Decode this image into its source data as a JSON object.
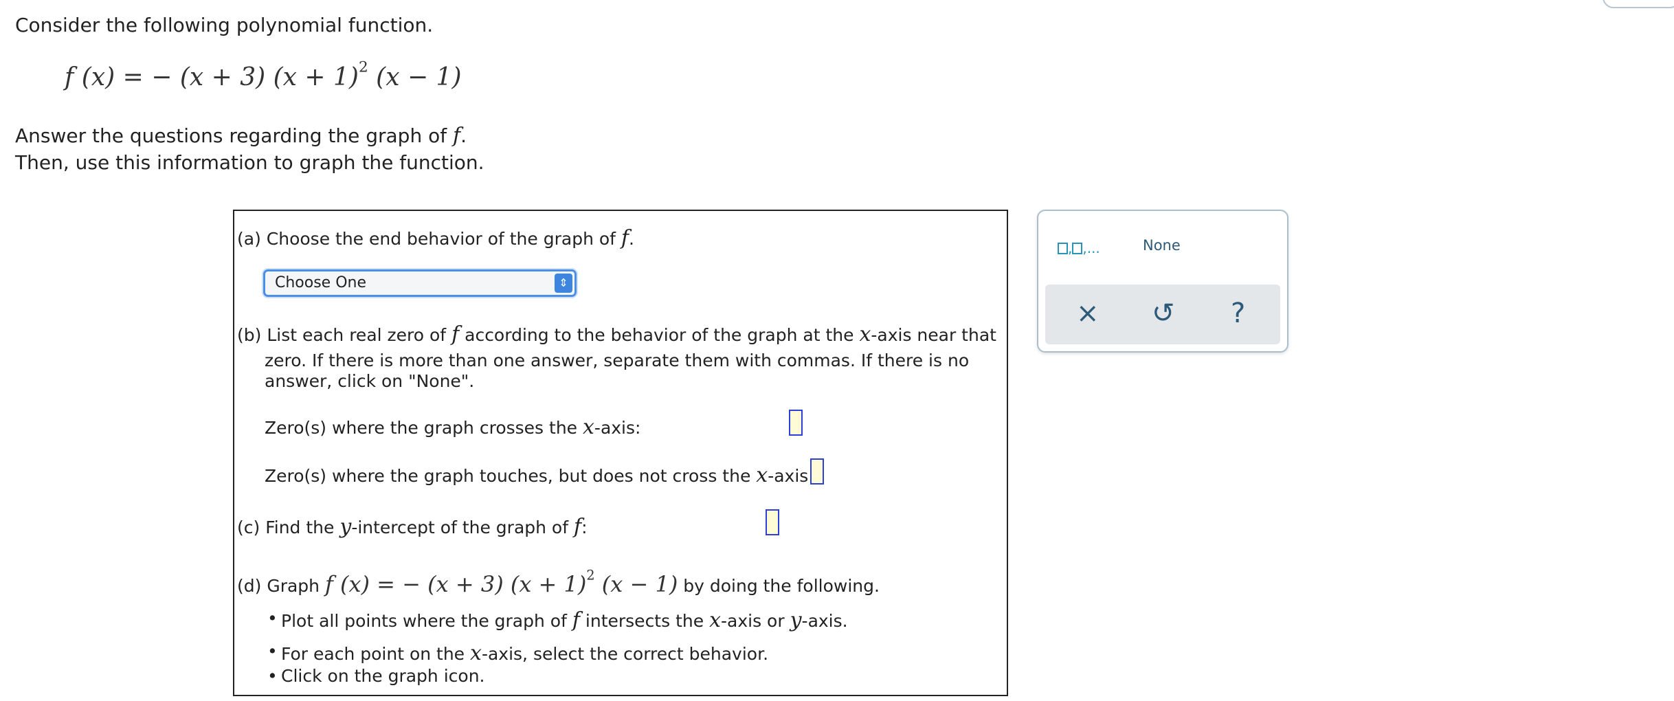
{
  "intro": {
    "line1": "Consider the following polynomial function.",
    "line2": "Answer the questions regarding the graph of",
    "line3": "Then, use this information to graph the function."
  },
  "func": {
    "lhs": "f (x) = − (x + 3) (x + 1)",
    "exp": "2",
    "tail": " (x − 1)"
  },
  "f": "f",
  "x": "x",
  "y": "y",
  "qa": {
    "label": "(a) Choose the end behavior of the graph of",
    "select_value": "Choose One"
  },
  "qb": {
    "line1_pre": "(b) List each real zero of",
    "line1_mid": "according to the behavior of the graph at the",
    "line1_post": "-axis near that",
    "line2": "zero. If there is more than one answer, separate them with commas. If there is no",
    "line3": "answer, click on \"None\".",
    "crosses_pre": "Zero(s) where the graph crosses the",
    "crosses_post": "-axis:",
    "touches_pre": "Zero(s) where the graph touches, but does not cross the",
    "touches_post": "-axis:"
  },
  "qc": {
    "pre": "(c) Find the",
    "mid": "-intercept of the graph of",
    "post": ":"
  },
  "qd": {
    "label": "(d) Graph",
    "suffix": "by doing the following.",
    "b1_pre": "Plot all points where the graph of",
    "b1_mid": "intersects the",
    "b1_mid2": "-axis or",
    "b1_post": "-axis.",
    "b2_pre": "For each point on the",
    "b2_post": "-axis, select the correct behavior.",
    "b3": "Click on the graph icon."
  },
  "palette": {
    "list_tool_suffix": ",...",
    "none_label": "None",
    "clear_icon": "×",
    "undo_icon": "↺",
    "help_icon": "?"
  }
}
